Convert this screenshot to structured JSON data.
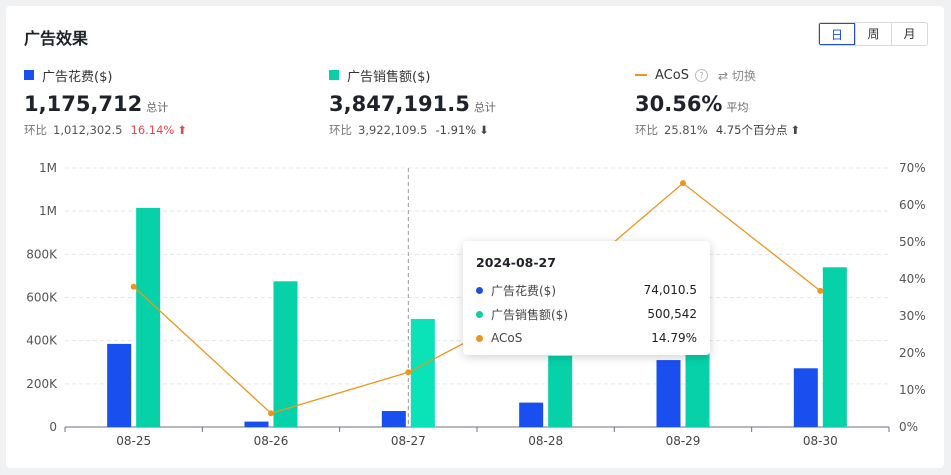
{
  "header": {
    "title": "广告效果"
  },
  "period_toggle": {
    "options": [
      "日",
      "周",
      "月"
    ],
    "active": "日"
  },
  "metrics": [
    {
      "name": "广告花费($)",
      "value": "1,175,712",
      "suffix": "总计",
      "cmp_label": "环比",
      "prev": "1,012,302.5",
      "change": "16.14%",
      "arrow": "⬆",
      "color": "#1a4fef"
    },
    {
      "name": "广告销售额($)",
      "value": "3,847,191.5",
      "suffix": "总计",
      "cmp_label": "环比",
      "prev": "3,922,109.5",
      "change": "-1.91%",
      "arrow": "⬇",
      "color": "#06d1a8"
    },
    {
      "name": "ACoS",
      "switch": "⇄ 切换",
      "value": "30.56%",
      "suffix": "平均",
      "cmp_label": "环比",
      "prev": "25.81%",
      "change": "4.75个百分点",
      "arrow": "⬆",
      "color": "#f0941c"
    }
  ],
  "tooltip": {
    "date": "2024-08-27",
    "rows": [
      {
        "name": "广告花费($)",
        "value": "74,010.5",
        "color": "#1a4fef"
      },
      {
        "name": "广告销售额($)",
        "value": "500,542",
        "color": "#06d1a8"
      },
      {
        "name": "ACoS",
        "value": "14.79%",
        "color": "#f0941c"
      }
    ]
  },
  "chart_data": {
    "type": "bar",
    "categories": [
      "08-25",
      "08-26",
      "08-27",
      "08-28",
      "08-29",
      "08-30"
    ],
    "series": [
      {
        "name": "广告花费($)",
        "type": "bar",
        "axis": "left",
        "color": "#1a4fef",
        "values": [
          385000,
          25000,
          74010.5,
          113000,
          310000,
          272000
        ]
      },
      {
        "name": "广告销售额($)",
        "type": "bar",
        "axis": "left",
        "color": "#06d1a8",
        "values": [
          1015000,
          675000,
          500542,
          330000,
          470000,
          740000
        ]
      },
      {
        "name": "ACoS",
        "type": "line",
        "axis": "right",
        "color": "#f0941c",
        "values": [
          37.9,
          3.7,
          14.79,
          34.2,
          65.9,
          36.8
        ]
      }
    ],
    "y_left": {
      "ticks": [
        "0",
        "200K",
        "400K",
        "600K",
        "800K",
        "1M",
        "1M"
      ],
      "min": 0,
      "max": 1200000
    },
    "y_right": {
      "ticks": [
        "0%",
        "10%",
        "20%",
        "30%",
        "40%",
        "50%",
        "60%",
        "70%"
      ],
      "min": 0,
      "max": 70
    },
    "hover_index": 2,
    "grid": true
  }
}
